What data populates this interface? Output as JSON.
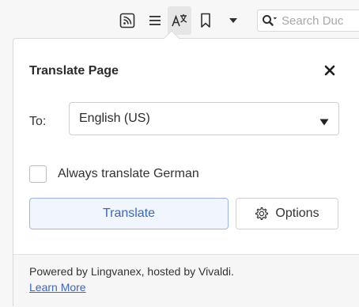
{
  "toolbar": {
    "icons": [
      "rss-icon",
      "reader-view-icon",
      "translate-icon",
      "bookmark-icon",
      "menu-caret-icon",
      "search-icon"
    ],
    "search_placeholder": "Search Duc"
  },
  "panel": {
    "title": "Translate Page",
    "close_glyph": "✕",
    "to_label": "To:",
    "language_selected": "English (US)",
    "always_translate_label": "Always translate German",
    "always_translate_checked": false,
    "translate_button": "Translate",
    "options_button": "Options",
    "footer": {
      "powered_text": "Powered by Lingvanex, hosted by Vivaldi.",
      "learn_more": "Learn More"
    }
  },
  "colors": {
    "accent": "#3a66c4",
    "accent_border": "#9db6e6",
    "panel_bg": "#ffffff",
    "footer_bg": "#f6f6f6"
  }
}
